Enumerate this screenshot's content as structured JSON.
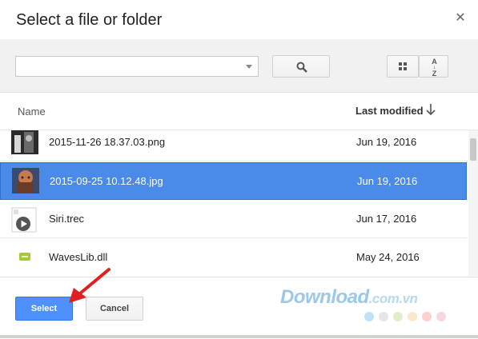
{
  "dialog": {
    "title": "Select a file or folder",
    "close_icon": "close-icon"
  },
  "toolbar": {
    "path_value": "",
    "search_icon": "search-icon",
    "grid_icon": "grid-view-icon",
    "sort_icon": "sort-az-icon",
    "sort_label_top": "A",
    "sort_label_bottom": "Z"
  },
  "columns": {
    "name": "Name",
    "last_modified": "Last modified"
  },
  "files": [
    {
      "name": "2015-11-26 18.37.03.png",
      "modified": "Jun 19, 2016",
      "selected": false,
      "icon": "image-thumbnail-icon"
    },
    {
      "name": "2015-09-25 10.12.48.jpg",
      "modified": "Jun 19, 2016",
      "selected": true,
      "icon": "image-thumbnail-icon"
    },
    {
      "name": "Siri.trec",
      "modified": "Jun 17, 2016",
      "selected": false,
      "icon": "video-file-icon"
    },
    {
      "name": "WavesLib.dll",
      "modified": "May 24, 2016",
      "selected": false,
      "icon": "dll-file-icon"
    }
  ],
  "footer": {
    "select_label": "Select",
    "cancel_label": "Cancel"
  },
  "watermark": {
    "text": "Download",
    "suffix": ".com.vn",
    "dot_colors": [
      "#bfe3f5",
      "#e6e6e6",
      "#dff0c8",
      "#fde7c9",
      "#fcd0d0",
      "#f7d6e4"
    ]
  },
  "colors": {
    "accent": "#4d90fe",
    "selected_row": "#4a8ae8",
    "annotation_arrow": "#e02020"
  }
}
